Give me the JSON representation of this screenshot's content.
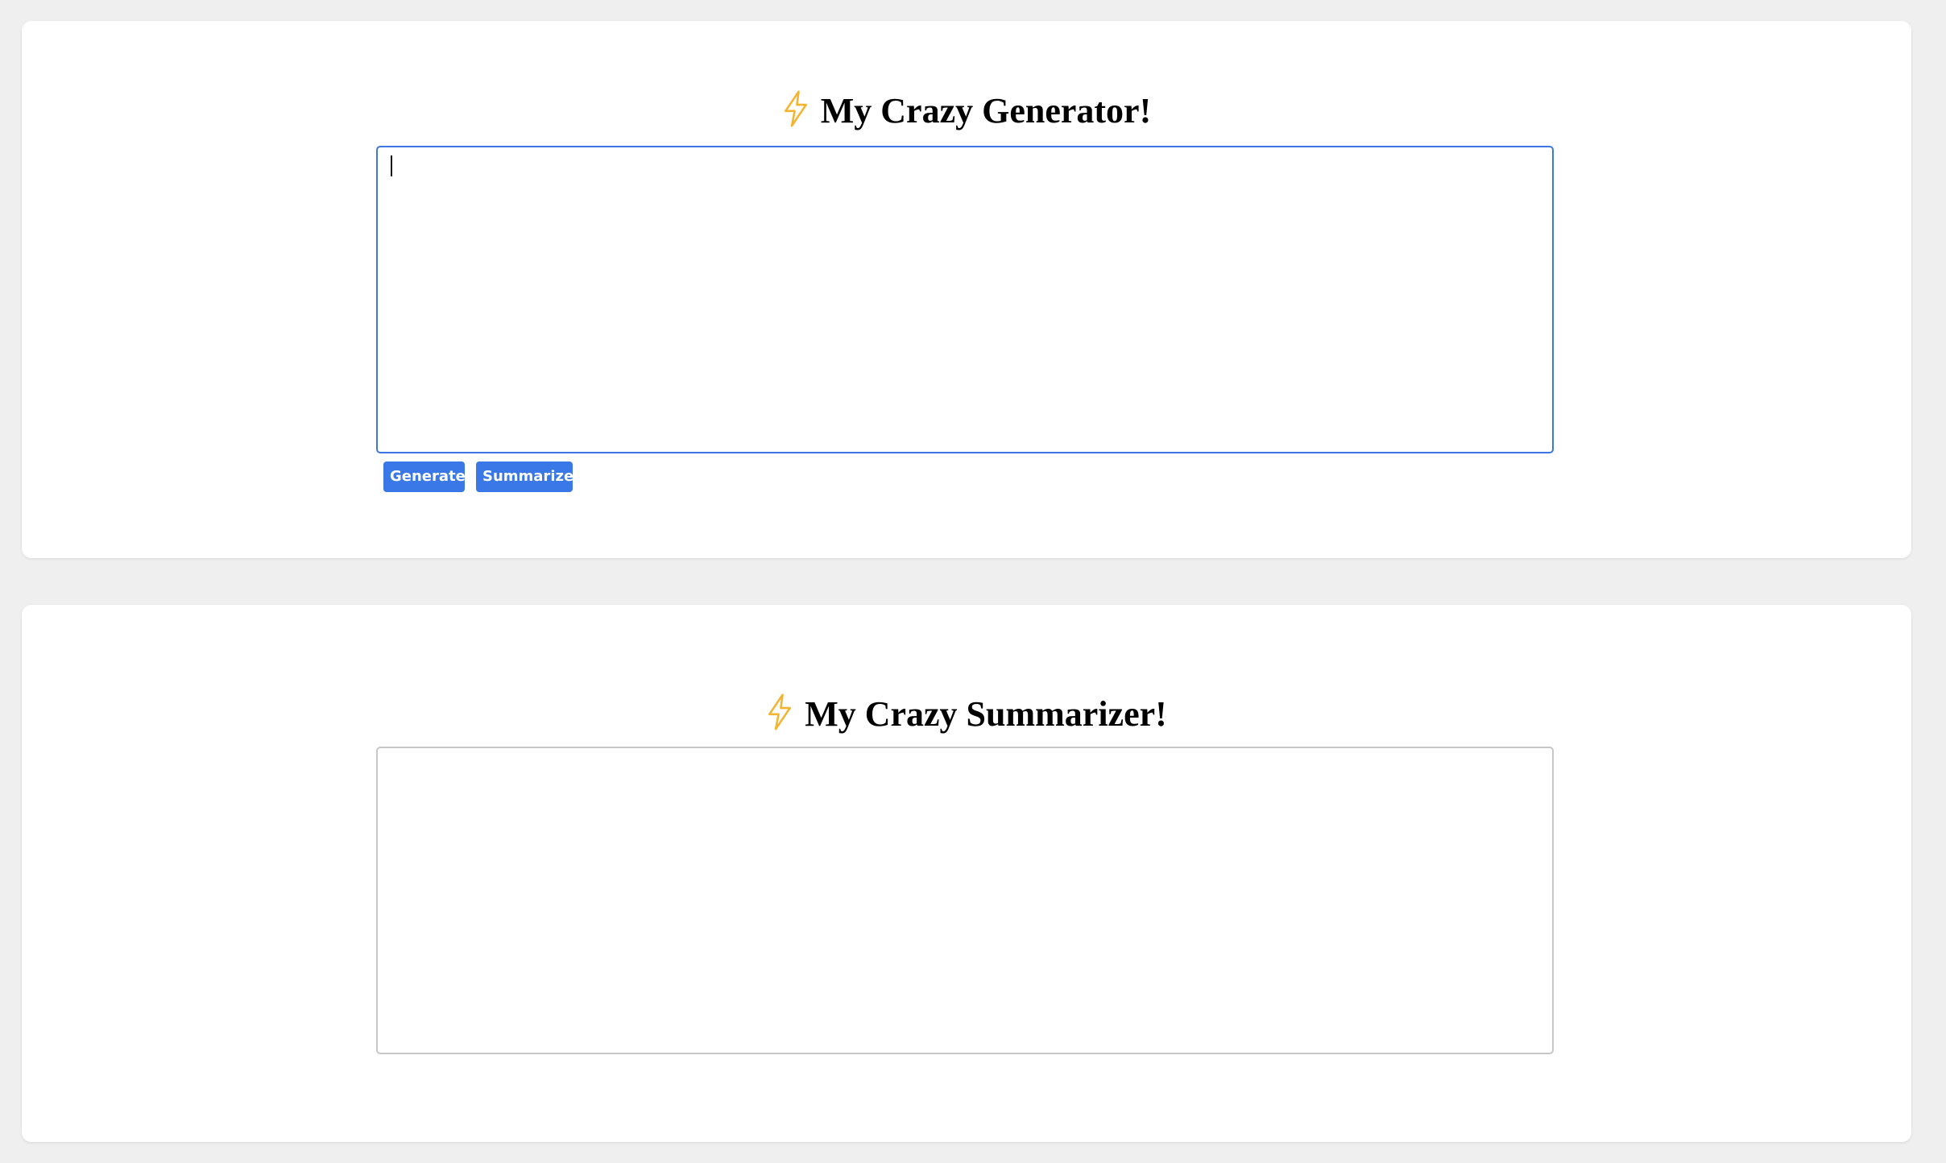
{
  "generator": {
    "title": "My Crazy Generator!",
    "icon": "lightning-bolt-icon",
    "textarea_value": "",
    "generate_label": "Generate",
    "summarize_label": "Summarize"
  },
  "summarizer": {
    "title": "My Crazy Summarizer!",
    "icon": "lightning-bolt-icon",
    "textarea_value": ""
  },
  "colors": {
    "accent": "#3b78e7",
    "bolt": "#f2b431",
    "page_background": "#efefef",
    "card_background": "#ffffff"
  }
}
